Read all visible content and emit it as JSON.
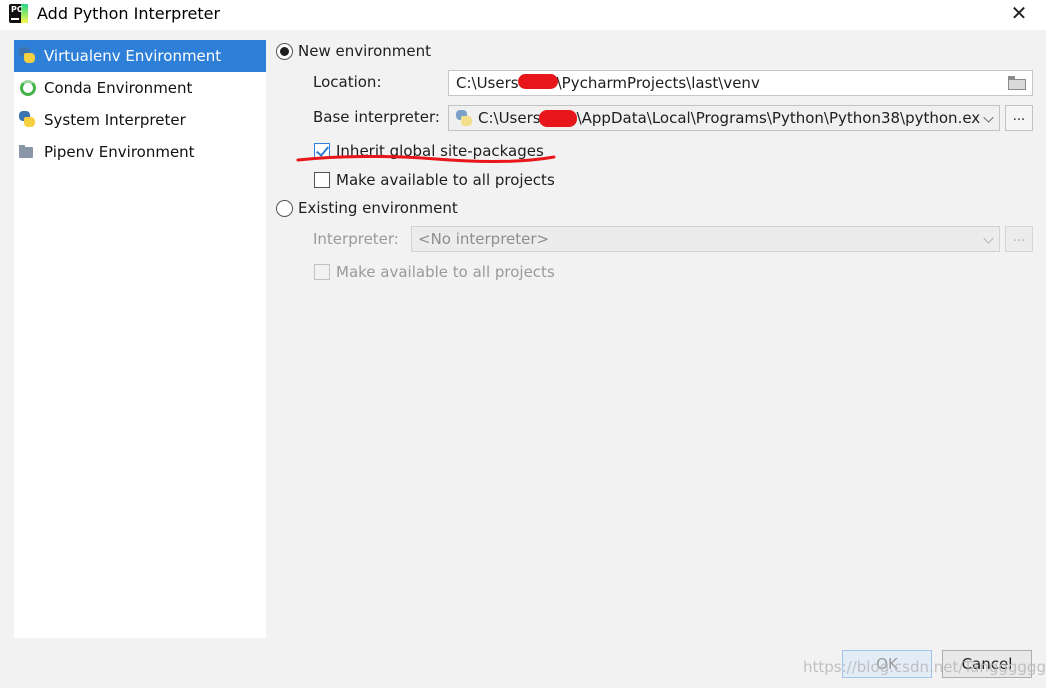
{
  "window": {
    "title": "Add Python Interpreter"
  },
  "sidebar": {
    "items": [
      {
        "label": "Virtualenv Environment",
        "icon": "python-icon",
        "selected": true
      },
      {
        "label": "Conda Environment",
        "icon": "conda-icon",
        "selected": false
      },
      {
        "label": "System Interpreter",
        "icon": "python-icon",
        "selected": false
      },
      {
        "label": "Pipenv Environment",
        "icon": "pipenv-icon",
        "selected": false
      }
    ]
  },
  "new_env": {
    "radio_label": "New environment",
    "selected": true,
    "location_label": "Location:",
    "location_value_a": "C:\\Users",
    "location_value_b": "\\PycharmProjects\\last\\venv",
    "base_label": "Base interpreter:",
    "base_value_a": "C:\\Users",
    "base_value_b": "\\AppData\\Local\\Programs\\Python\\Python38\\python.ex",
    "browse_label": "...",
    "inherit_label": "Inherit global site-packages",
    "inherit_checked": true,
    "make_available_label": "Make available to all projects",
    "make_available_checked": false
  },
  "existing_env": {
    "radio_label": "Existing environment",
    "selected": false,
    "interpreter_label": "Interpreter:",
    "interpreter_value": "<No interpreter>",
    "browse_label": "...",
    "make_available_label": "Make available to all projects",
    "make_available_checked": false
  },
  "footer": {
    "ok_label": "OK",
    "cancel_label": "Cancel",
    "watermark": "https://blog.csdn.net/Tanggggggggg"
  },
  "colors": {
    "accent": "#2e7fd8",
    "annotation_red": "#e8161b"
  }
}
